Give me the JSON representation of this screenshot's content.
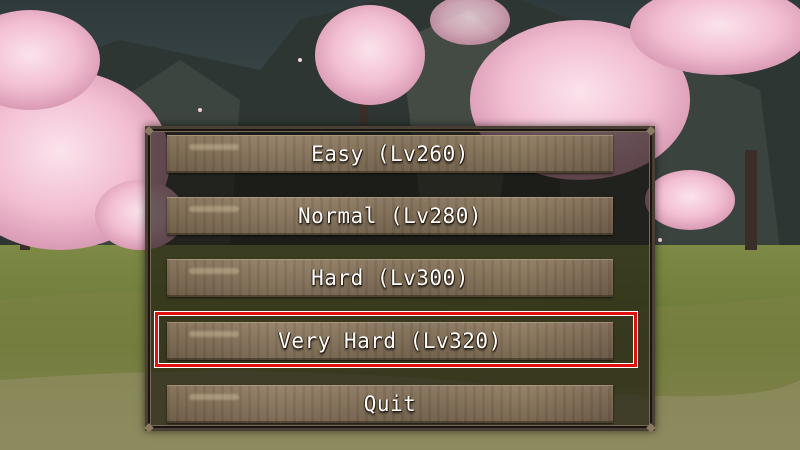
{
  "menu": {
    "items": [
      {
        "label": "Easy (Lv260)"
      },
      {
        "label": "Normal (Lv280)"
      },
      {
        "label": "Hard (Lv300)"
      },
      {
        "label": "Very Hard (Lv320)"
      },
      {
        "label": "Quit"
      }
    ],
    "selected_index": 3
  },
  "colors": {
    "selection_border": "#e01010",
    "button_text": "#ffffff",
    "button_wood": "#8d7a61",
    "frame_border": "#4a3f34",
    "sky": "#3b4548",
    "grass": "#6f7a3c",
    "blossom": "#f3c5d6"
  },
  "icons": {
    "frame_corner": "ornament-corner-icon"
  }
}
